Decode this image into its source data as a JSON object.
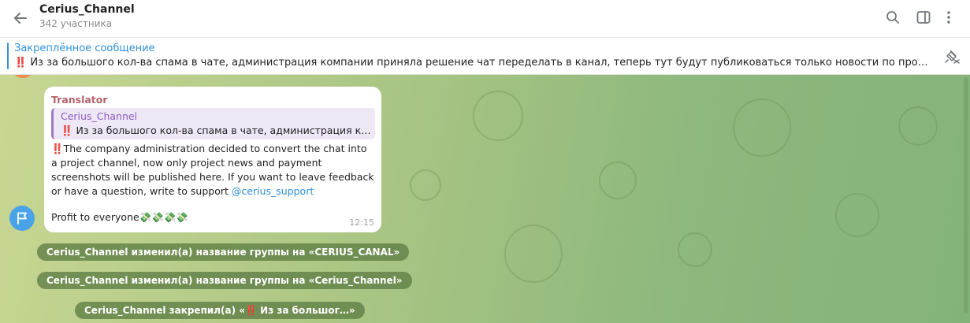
{
  "header": {
    "title": "Cerius_Channel",
    "subtitle": "342 участника"
  },
  "pinned": {
    "title": "Закреплённое сообщение",
    "text": "‼️ Из за большого кол-ва спама в чате, администрация компании приняла решение чат переделать в канал, теперь тут будут публиковаться только новости по проекту и скрины вы…"
  },
  "message": {
    "sender": "Translator",
    "reply_name": "Cerius_Channel",
    "reply_text": "‼️ Из за большого кол-ва спама в чате, администрация ком…",
    "text": "‼️The company administration decided to convert the chat into a project channel, now only project news and payment screenshots will be published here. If you want to leave feedback or have a question, write to support ",
    "link": "@cerius_support",
    "profit": "Profit to everyone💸💸💸💸",
    "time": "12:15"
  },
  "service": [
    "Cerius_Channel изменил(а) название группы на «CERIUS_CANAL»",
    "Cerius_Channel изменил(а) название группы на «Cerius_Channel»",
    "Cerius_Channel закрепил(а) «‼️ Из за большог…»"
  ],
  "colors": {
    "accent": "#2f8fdb",
    "sender": "#b5646b",
    "reply_name": "#8a5cc0"
  }
}
